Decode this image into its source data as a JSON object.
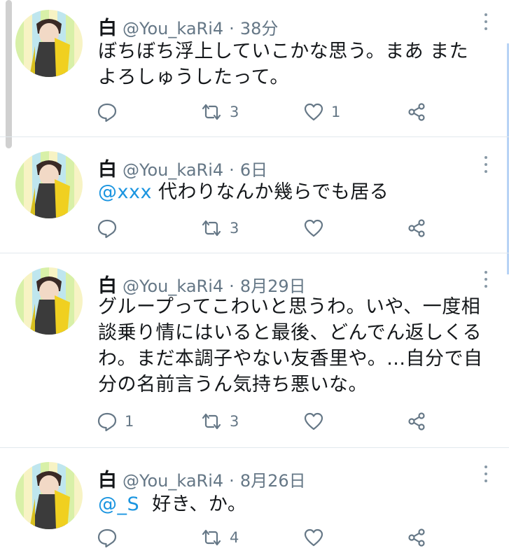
{
  "tweets": [
    {
      "name": "白",
      "handle": "@You_kaRi4",
      "dot": "·",
      "time": "38分",
      "lines": [
        "ぼちぼち浮上していこかな思う。まあ また",
        "よろしゅうしたって。"
      ],
      "mention": "",
      "reply_count": "",
      "retweet_count": "3",
      "like_count": "1"
    },
    {
      "name": "白",
      "handle": "@You_kaRi4",
      "dot": "·",
      "time": "6日",
      "mention": "@xxx",
      "lines": [
        " 代わりなんか幾らでも居る"
      ],
      "reply_count": "",
      "retweet_count": "3",
      "like_count": ""
    },
    {
      "name": "白",
      "handle": "@You_kaRi4",
      "dot": "·",
      "time": "8月29日",
      "mention": "",
      "lines": [
        "グループってこわいと思うわ。いや、一度相",
        "談乗り情にはいると最後、どんでん返しくる",
        "わ。まだ本調子やない友香里や。...自分で自",
        "分の名前言うん気持ち悪いな。"
      ],
      "reply_count": "1",
      "retweet_count": "3",
      "like_count": ""
    },
    {
      "name": "白",
      "handle": "@You_kaRi4",
      "dot": "·",
      "time": "8月26日",
      "mention": "@_S",
      "lines": [
        "  好き、か。"
      ],
      "reply_count": "",
      "retweet_count": "4",
      "like_count": ""
    }
  ],
  "icons": {
    "reply": "reply-icon",
    "retweet": "retweet-icon",
    "like": "heart-icon",
    "share": "share-icon",
    "more": "more-vertical-icon"
  },
  "colors": {
    "text": "#14171a",
    "secondary": "#657786",
    "mention": "#1b95e0",
    "divider": "#e1e8ed"
  }
}
